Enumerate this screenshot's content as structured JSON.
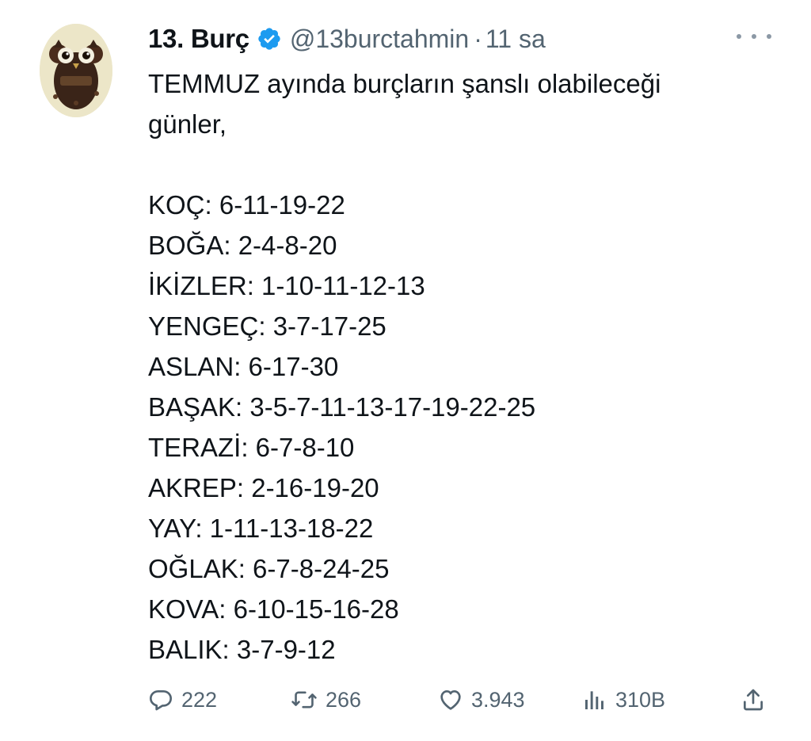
{
  "author": {
    "display_name": "13. Burç",
    "handle": "@13burctahmin",
    "separator": "·",
    "time": "11 sa",
    "verified_color": "#1d9bf0",
    "avatar_icon": "owl-avatar-icon"
  },
  "tweet": {
    "intro_line1": "TEMMUZ ayında burçların şanslı olabileceği",
    "intro_line2": "günler,",
    "signs": [
      "KOÇ: 6-11-19-22",
      "BOĞA: 2-4-8-20",
      "İKİZLER: 1-10-11-12-13",
      "YENGEÇ: 3-7-17-25",
      "ASLAN: 6-17-30",
      "BAŞAK: 3-5-7-11-13-17-19-22-25",
      "TERAZİ: 6-7-8-10",
      "AKREP: 2-16-19-20",
      "YAY: 1-11-13-18-22",
      "OĞLAK: 6-7-8-24-25",
      "KOVA: 6-10-15-16-28",
      "BALIK: 3-7-9-12"
    ]
  },
  "actions": {
    "replies": "222",
    "retweets": "266",
    "likes": "3.943",
    "views": "310B",
    "icons": [
      "reply-icon",
      "retweet-icon",
      "like-icon",
      "views-icon",
      "share-icon"
    ]
  }
}
